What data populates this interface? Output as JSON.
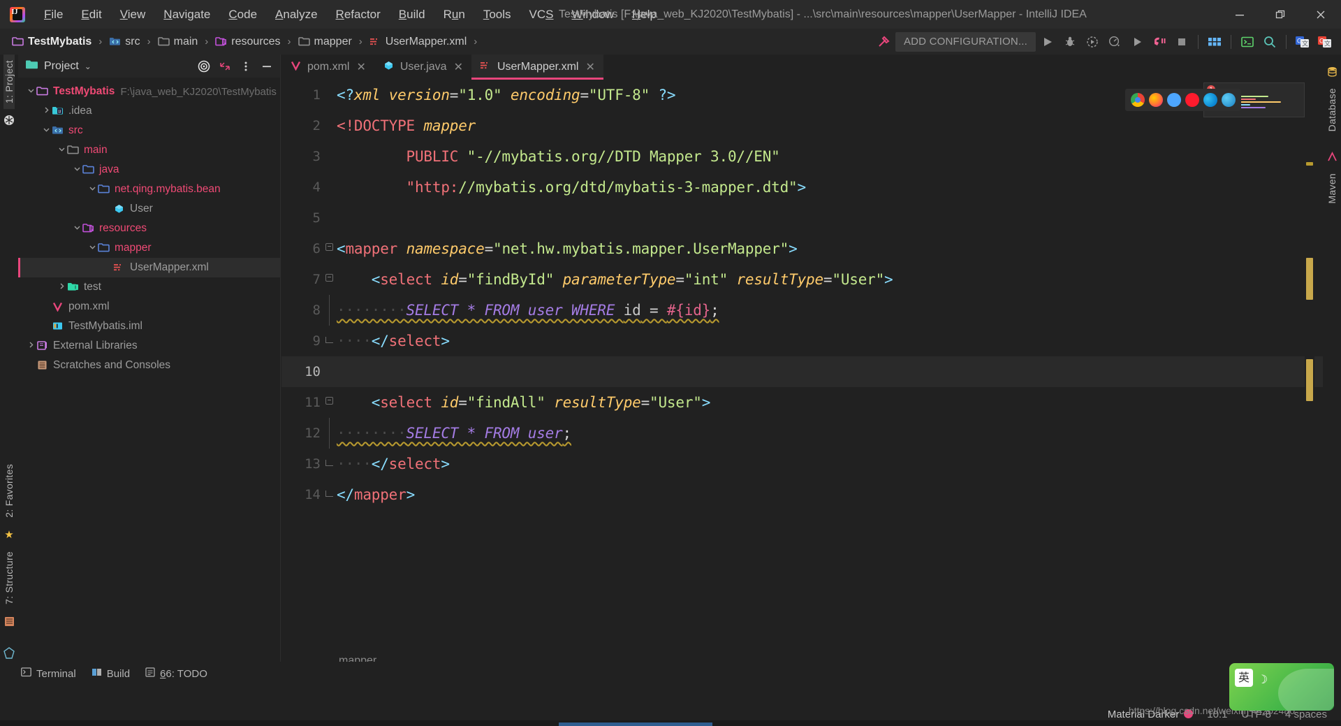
{
  "window": {
    "title": "TestMybatis [F:\\java_web_KJ2020\\TestMybatis] - ...\\src\\main\\resources\\mapper\\UserMapper - IntelliJ IDEA",
    "minimize": "—",
    "restore": "❐",
    "close": "✕"
  },
  "menubar": {
    "items": [
      {
        "label": "File",
        "mnemonic": "F"
      },
      {
        "label": "Edit",
        "mnemonic": "E"
      },
      {
        "label": "View",
        "mnemonic": "V"
      },
      {
        "label": "Navigate",
        "mnemonic": "N"
      },
      {
        "label": "Code",
        "mnemonic": "C"
      },
      {
        "label": "Analyze",
        "mnemonic": "A"
      },
      {
        "label": "Refactor",
        "mnemonic": "R"
      },
      {
        "label": "Build",
        "mnemonic": "B"
      },
      {
        "label": "Run",
        "mnemonic": "u"
      },
      {
        "label": "Tools",
        "mnemonic": "T"
      },
      {
        "label": "VCS",
        "mnemonic": "S"
      },
      {
        "label": "Window",
        "mnemonic": "W"
      },
      {
        "label": "Help",
        "mnemonic": "H"
      }
    ]
  },
  "breadcrumb": {
    "separator": "›",
    "items": [
      {
        "label": "TestMybatis",
        "icon": "project-folder-icon"
      },
      {
        "label": "src",
        "icon": "source-root-icon"
      },
      {
        "label": "main",
        "icon": "folder-icon"
      },
      {
        "label": "resources",
        "icon": "resources-root-icon"
      },
      {
        "label": "mapper",
        "icon": "folder-icon"
      },
      {
        "label": "UserMapper.xml",
        "icon": "xml-file-icon"
      }
    ]
  },
  "toolbar": {
    "add_configuration": "ADD CONFIGURATION...",
    "icons": [
      {
        "name": "build-hammer-icon",
        "glyph": "⚒"
      },
      {
        "name": "run-icon",
        "glyph": "▶"
      },
      {
        "name": "debug-icon",
        "glyph": "🐞"
      },
      {
        "name": "run-with-coverage-icon",
        "glyph": "◔"
      },
      {
        "name": "profiler-icon",
        "glyph": "◴"
      },
      {
        "name": "run-anything-icon",
        "glyph": "▶"
      },
      {
        "name": "stop-call-icon",
        "glyph": "☎"
      },
      {
        "name": "stop-icon",
        "glyph": "■"
      },
      {
        "name": "tool-windows-icon",
        "glyph": "☷"
      },
      {
        "name": "terminal-icon",
        "glyph": "⌨"
      },
      {
        "name": "search-everywhere-icon",
        "glyph": "🔍"
      },
      {
        "name": "google-translate-icon",
        "glyph": "G"
      },
      {
        "name": "translate-plugin-icon",
        "glyph": "G"
      }
    ]
  },
  "left_stripe": {
    "tabs": [
      {
        "label": "1: Project",
        "selected": true
      },
      {
        "label": "2: Favorites",
        "selected": false
      },
      {
        "label": "7: Structure",
        "selected": false
      }
    ],
    "icons": [
      {
        "name": "version-control-icon",
        "glyph": "Ⓥ"
      },
      {
        "name": "favorites-star-icon",
        "glyph": "★"
      },
      {
        "name": "database-bottom-icon",
        "glyph": "▤"
      }
    ]
  },
  "project_panel": {
    "title": "Project",
    "chevron": "⌄",
    "actions": [
      {
        "name": "select-opened-file-icon",
        "glyph": "◎"
      },
      {
        "name": "collapse-all-icon",
        "glyph": "↙"
      },
      {
        "name": "options-menu-icon",
        "glyph": "⋮"
      },
      {
        "name": "hide-panel-icon",
        "glyph": "—"
      }
    ],
    "tree": [
      {
        "label": "TestMybatis",
        "path": "F:\\java_web_KJ2020\\TestMybatis",
        "depth": 0,
        "arrow": "down",
        "icon": "project-folder-icon",
        "style": "root",
        "selected": false
      },
      {
        "label": ".idea",
        "path": "",
        "depth": 1,
        "arrow": "right",
        "icon": "idea-folder-icon",
        "style": "plain",
        "selected": false
      },
      {
        "label": "src",
        "path": "",
        "depth": 1,
        "arrow": "down",
        "icon": "source-root-icon",
        "style": "pink",
        "selected": false
      },
      {
        "label": "main",
        "path": "",
        "depth": 2,
        "arrow": "down",
        "icon": "folder-icon",
        "style": "pink",
        "selected": false
      },
      {
        "label": "java",
        "path": "",
        "depth": 3,
        "arrow": "down",
        "icon": "folder-blue-icon",
        "style": "pink",
        "selected": false
      },
      {
        "label": "net.qing.mybatis.bean",
        "path": "",
        "depth": 4,
        "arrow": "down",
        "icon": "package-icon",
        "style": "pink",
        "selected": false
      },
      {
        "label": "User",
        "path": "",
        "depth": 5,
        "arrow": "none",
        "icon": "java-class-icon",
        "style": "plain",
        "selected": false
      },
      {
        "label": "resources",
        "path": "",
        "depth": 3,
        "arrow": "down",
        "icon": "resources-root-icon",
        "style": "pink",
        "selected": false
      },
      {
        "label": "mapper",
        "path": "",
        "depth": 4,
        "arrow": "down",
        "icon": "folder-blue-icon",
        "style": "pink",
        "selected": false
      },
      {
        "label": "UserMapper.xml",
        "path": "",
        "depth": 5,
        "arrow": "none",
        "icon": "xml-file-icon",
        "style": "plain",
        "selected": true
      },
      {
        "label": "test",
        "path": "",
        "depth": 2,
        "arrow": "right",
        "icon": "test-root-icon",
        "style": "plain",
        "selected": false
      },
      {
        "label": "pom.xml",
        "path": "",
        "depth": 1,
        "arrow": "none",
        "icon": "maven-icon",
        "style": "plain",
        "selected": false
      },
      {
        "label": "TestMybatis.iml",
        "path": "",
        "depth": 1,
        "arrow": "none",
        "icon": "iml-file-icon",
        "style": "plain",
        "selected": false
      },
      {
        "label": "External Libraries",
        "path": "",
        "depth": 0,
        "arrow": "right",
        "icon": "libraries-icon",
        "style": "plain",
        "selected": false
      },
      {
        "label": "Scratches and Consoles",
        "path": "",
        "depth": 0,
        "arrow": "none",
        "icon": "scratches-icon",
        "style": "plain",
        "selected": false
      }
    ]
  },
  "editor": {
    "tabs": [
      {
        "label": "pom.xml",
        "icon": "maven-icon",
        "active": false,
        "close": "✕"
      },
      {
        "label": "User.java",
        "icon": "java-class-icon",
        "active": false,
        "close": "✕"
      },
      {
        "label": "UserMapper.xml",
        "icon": "xml-file-icon",
        "active": true,
        "close": "✕"
      }
    ],
    "breadcrumb_bottom": "mapper",
    "current_line": 10,
    "lines": [
      {
        "n": 1,
        "fold": "none",
        "tokens": [
          {
            "t": "<?",
            "c": "t-brkt"
          },
          {
            "t": "xml",
            "c": "t-dtdname"
          },
          {
            "t": " ",
            "c": "t-punct"
          },
          {
            "t": "version",
            "c": "t-attr"
          },
          {
            "t": "=",
            "c": "t-eq"
          },
          {
            "t": "\"1.0\"",
            "c": "t-str"
          },
          {
            "t": " ",
            "c": "t-punct"
          },
          {
            "t": "encoding",
            "c": "t-attr"
          },
          {
            "t": "=",
            "c": "t-eq"
          },
          {
            "t": "\"UTF-8\"",
            "c": "t-str"
          },
          {
            "t": " ",
            "c": "t-punct"
          },
          {
            "t": "?>",
            "c": "t-brkt"
          }
        ]
      },
      {
        "n": 2,
        "fold": "none",
        "tokens": [
          {
            "t": "<!DOCTYPE",
            "c": "t-doctype"
          },
          {
            "t": " ",
            "c": "t-punct"
          },
          {
            "t": "mapper",
            "c": "t-dtdname"
          }
        ]
      },
      {
        "n": 3,
        "fold": "none",
        "tokens": [
          {
            "t": "        PUBLIC ",
            "c": "t-url"
          },
          {
            "t": "\"-//mybatis.org//DTD Mapper 3.0//EN\"",
            "c": "t-str"
          }
        ]
      },
      {
        "n": 4,
        "fold": "none",
        "tokens": [
          {
            "t": "        ",
            "c": "t-punct"
          },
          {
            "t": "\"http:",
            "c": "t-url"
          },
          {
            "t": "//mybatis.org/dtd/mybatis-3-mapper.dtd\"",
            "c": "t-str"
          },
          {
            "t": ">",
            "c": "t-brkt"
          }
        ]
      },
      {
        "n": 5,
        "fold": "none",
        "tokens": []
      },
      {
        "n": 6,
        "fold": "start",
        "tokens": [
          {
            "t": "<",
            "c": "t-brkt"
          },
          {
            "t": "mapper",
            "c": "t-tag"
          },
          {
            "t": " ",
            "c": "t-punct"
          },
          {
            "t": "namespace",
            "c": "t-attr"
          },
          {
            "t": "=",
            "c": "t-eq"
          },
          {
            "t": "\"net.hw.mybatis.mapper.UserMapper\"",
            "c": "t-str"
          },
          {
            "t": ">",
            "c": "t-brkt"
          }
        ]
      },
      {
        "n": 7,
        "fold": "start",
        "tokens": [
          {
            "t": "    ",
            "c": "t-punct"
          },
          {
            "t": "<",
            "c": "t-brkt"
          },
          {
            "t": "select",
            "c": "t-tag"
          },
          {
            "t": " ",
            "c": "t-punct"
          },
          {
            "t": "id",
            "c": "t-attr"
          },
          {
            "t": "=",
            "c": "t-eq"
          },
          {
            "t": "\"findById\"",
            "c": "t-str"
          },
          {
            "t": " ",
            "c": "t-punct"
          },
          {
            "t": "parameterType",
            "c": "t-attr"
          },
          {
            "t": "=",
            "c": "t-eq"
          },
          {
            "t": "\"int\"",
            "c": "t-str"
          },
          {
            "t": " ",
            "c": "t-punct"
          },
          {
            "t": "resultType",
            "c": "t-attr"
          },
          {
            "t": "=",
            "c": "t-eq"
          },
          {
            "t": "\"User\"",
            "c": "t-str"
          },
          {
            "t": ">",
            "c": "t-brkt"
          }
        ]
      },
      {
        "n": 8,
        "fold": "bar",
        "wavy": true,
        "indent": true,
        "tokens": [
          {
            "t": "        ",
            "c": "ws-dots"
          },
          {
            "t": "SELECT * FROM user WHERE ",
            "c": "t-sql"
          },
          {
            "t": "id",
            "c": "t-sqlid"
          },
          {
            "t": " = ",
            "c": "t-punct"
          },
          {
            "t": "#{id}",
            "c": "t-param"
          },
          {
            "t": ";",
            "c": "t-punct"
          }
        ]
      },
      {
        "n": 9,
        "fold": "end",
        "tokens": [
          {
            "t": "    ",
            "c": "ws-dots"
          },
          {
            "t": "</",
            "c": "t-brkt"
          },
          {
            "t": "select",
            "c": "t-tag"
          },
          {
            "t": ">",
            "c": "t-brkt"
          }
        ]
      },
      {
        "n": 10,
        "fold": "none",
        "current": true,
        "tokens": []
      },
      {
        "n": 11,
        "fold": "start",
        "tokens": [
          {
            "t": "    ",
            "c": "t-punct"
          },
          {
            "t": "<",
            "c": "t-brkt"
          },
          {
            "t": "select",
            "c": "t-tag"
          },
          {
            "t": " ",
            "c": "t-punct"
          },
          {
            "t": "id",
            "c": "t-attr"
          },
          {
            "t": "=",
            "c": "t-eq"
          },
          {
            "t": "\"findAll\"",
            "c": "t-str"
          },
          {
            "t": " ",
            "c": "t-punct"
          },
          {
            "t": "resultType",
            "c": "t-attr"
          },
          {
            "t": "=",
            "c": "t-eq"
          },
          {
            "t": "\"User\"",
            "c": "t-str"
          },
          {
            "t": ">",
            "c": "t-brkt"
          }
        ]
      },
      {
        "n": 12,
        "fold": "bar",
        "wavy": true,
        "indent": true,
        "tokens": [
          {
            "t": "        ",
            "c": "ws-dots"
          },
          {
            "t": "SELECT * FROM user",
            "c": "t-sql"
          },
          {
            "t": ";",
            "c": "t-punct"
          }
        ]
      },
      {
        "n": 13,
        "fold": "end",
        "tokens": [
          {
            "t": "    ",
            "c": "ws-dots"
          },
          {
            "t": "</",
            "c": "t-brkt"
          },
          {
            "t": "select",
            "c": "t-tag"
          },
          {
            "t": ">",
            "c": "t-brkt"
          }
        ]
      },
      {
        "n": 14,
        "fold": "end",
        "tokens": [
          {
            "t": "</",
            "c": "t-brkt"
          },
          {
            "t": "mapper",
            "c": "t-tag"
          },
          {
            "t": ">",
            "c": "t-brkt"
          }
        ]
      }
    ]
  },
  "browser_popup": {
    "browsers": [
      {
        "name": "chrome-icon",
        "color": "#4285f4"
      },
      {
        "name": "firefox-icon",
        "color": "#ff9500"
      },
      {
        "name": "chromium-icon",
        "color": "#4da6ff"
      },
      {
        "name": "opera-icon",
        "color": "#ff1b2d"
      },
      {
        "name": "edge-icon",
        "color": "#0a84d1"
      },
      {
        "name": "ie-icon",
        "color": "#1ebbee"
      }
    ]
  },
  "right_stripe": {
    "tabs": [
      {
        "label": "Database"
      },
      {
        "label": "Maven"
      }
    ],
    "icons": [
      {
        "name": "database-icon",
        "glyph": "▤"
      },
      {
        "name": "maven-m-icon",
        "glyph": "m"
      }
    ]
  },
  "bottom_bar": {
    "items": [
      {
        "label": "Terminal",
        "icon": "terminal-icon",
        "mnemonic": ""
      },
      {
        "label": "Build",
        "icon": "build-icon",
        "mnemonic": ""
      },
      {
        "label": "6: TODO",
        "icon": "todo-icon",
        "mnemonic": "6"
      }
    ]
  },
  "statusbar": {
    "theme": "Material Darker",
    "theme_dot_color": "#e8467c",
    "caret_position": "10:1",
    "encoding": "UTF-8",
    "indent": "4 spaces",
    "watermark": "https://blog.csdn.net/weixin_44202480"
  },
  "ime": {
    "mode_label": "英",
    "moon_glyph": "☽"
  }
}
